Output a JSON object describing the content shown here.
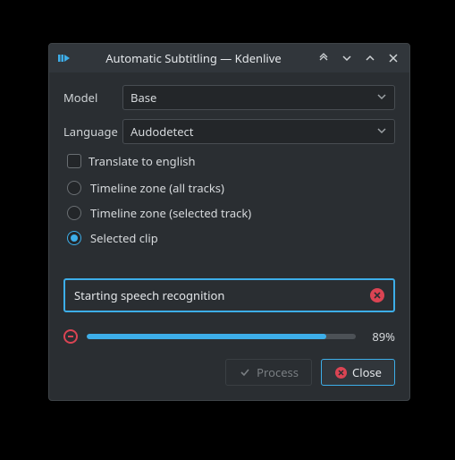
{
  "window": {
    "title": "Automatic Subtitling — Kdenlive"
  },
  "form": {
    "model_label": "Model",
    "model_value": "Base",
    "language_label": "Language",
    "language_value": "Audodetect",
    "translate_label": "Translate to english"
  },
  "radios": {
    "option1": "Timeline zone (all tracks)",
    "option2": "Timeline zone (selected track)",
    "option3": "Selected clip",
    "selected_index": 2
  },
  "status": {
    "text": "Starting speech recognition"
  },
  "progress": {
    "percent": 89,
    "label": "89%"
  },
  "buttons": {
    "process": "Process",
    "close": "Close"
  },
  "colors": {
    "accent": "#3daee9",
    "danger": "#da4453",
    "window_bg": "#2a2e32",
    "titlebar_bg": "#31363b"
  }
}
